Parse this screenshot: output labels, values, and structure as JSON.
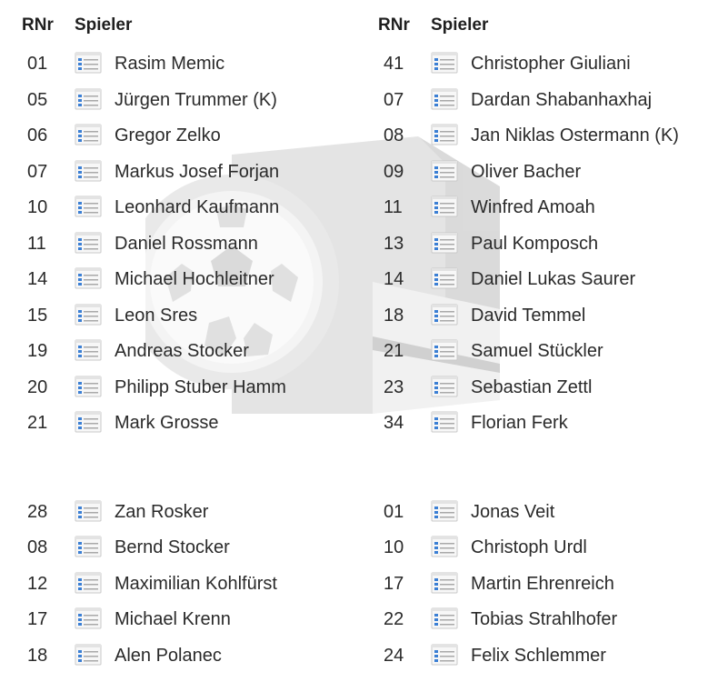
{
  "headers": {
    "number": "RNr",
    "player": "Spieler"
  },
  "icons": {
    "player_card": "player-card-icon",
    "watermark": "whistle-icon"
  },
  "colors": {
    "text": "#2a2a2a",
    "header_text": "#1f1f1f",
    "icon_blue": "#3b7fd4",
    "icon_border": "#c8c8c8",
    "watermark_gray": "#d9d9d9"
  },
  "left_team": {
    "starting": [
      {
        "number": "01",
        "name": "Rasim Memic"
      },
      {
        "number": "05",
        "name": "Jürgen Trummer (K)"
      },
      {
        "number": "06",
        "name": "Gregor Zelko"
      },
      {
        "number": "07",
        "name": "Markus Josef Forjan"
      },
      {
        "number": "10",
        "name": "Leonhard Kaufmann"
      },
      {
        "number": "11",
        "name": "Daniel Rossmann"
      },
      {
        "number": "14",
        "name": "Michael Hochleitner"
      },
      {
        "number": "15",
        "name": "Leon Sres"
      },
      {
        "number": "19",
        "name": "Andreas Stocker"
      },
      {
        "number": "20",
        "name": "Philipp Stuber Hamm"
      },
      {
        "number": "21",
        "name": "Mark Grosse"
      }
    ],
    "substitutes": [
      {
        "number": "28",
        "name": "Zan Rosker"
      },
      {
        "number": "08",
        "name": "Bernd Stocker"
      },
      {
        "number": "12",
        "name": "Maximilian Kohlfürst"
      },
      {
        "number": "17",
        "name": "Michael Krenn"
      },
      {
        "number": "18",
        "name": "Alen Polanec"
      }
    ]
  },
  "right_team": {
    "starting": [
      {
        "number": "41",
        "name": "Christopher Giuliani"
      },
      {
        "number": "07",
        "name": "Dardan Shabanhaxhaj"
      },
      {
        "number": "08",
        "name": "Jan Niklas Ostermann (K)"
      },
      {
        "number": "09",
        "name": "Oliver Bacher"
      },
      {
        "number": "11",
        "name": "Winfred Amoah"
      },
      {
        "number": "13",
        "name": "Paul Komposch"
      },
      {
        "number": "14",
        "name": "Daniel Lukas Saurer"
      },
      {
        "number": "18",
        "name": "David Temmel"
      },
      {
        "number": "21",
        "name": "Samuel Stückler"
      },
      {
        "number": "23",
        "name": "Sebastian Zettl"
      },
      {
        "number": "34",
        "name": "Florian Ferk"
      }
    ],
    "substitutes": [
      {
        "number": "01",
        "name": "Jonas Veit"
      },
      {
        "number": "10",
        "name": "Christoph Urdl"
      },
      {
        "number": "17",
        "name": "Martin Ehrenreich"
      },
      {
        "number": "22",
        "name": "Tobias Strahlhofer"
      },
      {
        "number": "24",
        "name": "Felix Schlemmer"
      }
    ]
  }
}
